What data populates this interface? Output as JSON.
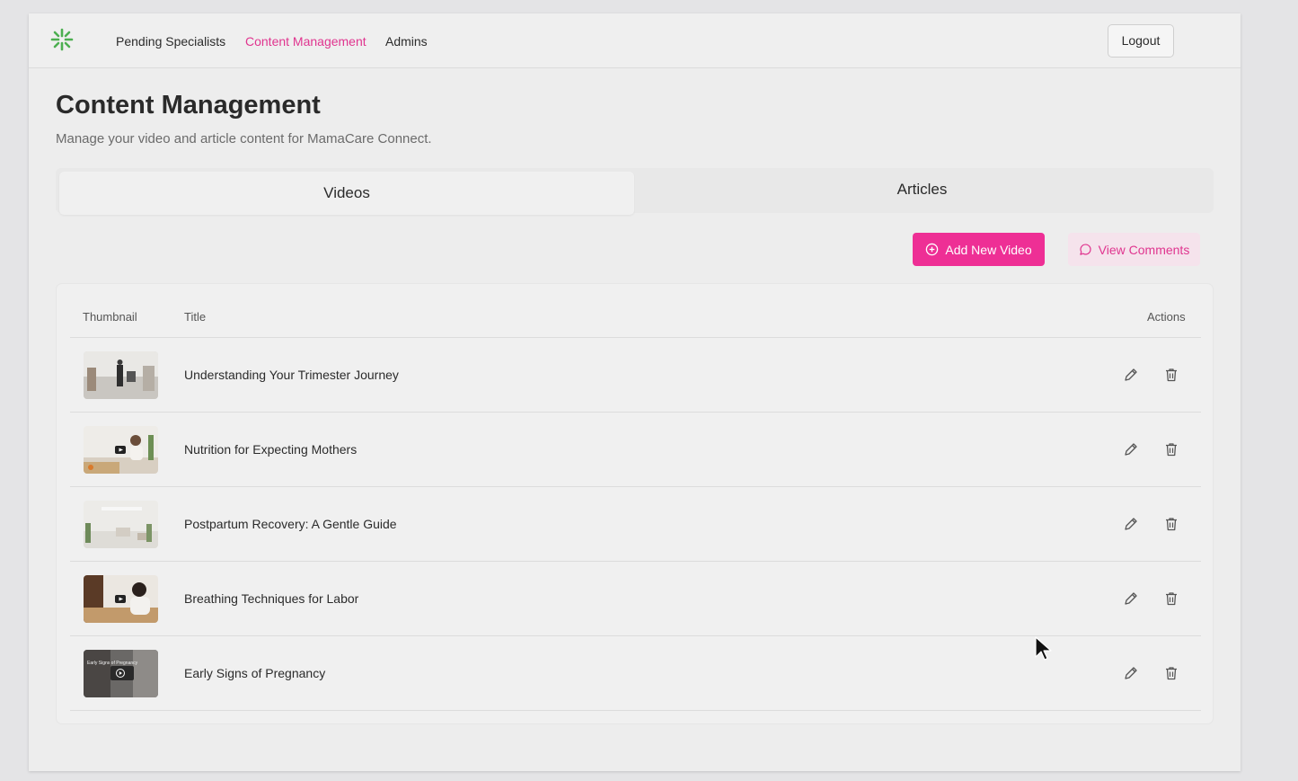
{
  "nav": {
    "links": [
      "Pending Specialists",
      "Content Management",
      "Admins"
    ],
    "active": "Content Management",
    "logout_label": "Logout"
  },
  "header": {
    "title": "Content Management",
    "subtitle": "Manage your video and article content for MamaCare Connect."
  },
  "tabs": [
    {
      "label": "Videos",
      "active": true
    },
    {
      "label": "Articles",
      "active": false
    }
  ],
  "toolbar": {
    "add_label": "Add New Video",
    "comments_label": "View Comments"
  },
  "table": {
    "columns": {
      "thumbnail": "Thumbnail",
      "title": "Title",
      "actions": "Actions"
    },
    "rows": [
      {
        "title": "Understanding Your Trimester Journey"
      },
      {
        "title": "Nutrition for Expecting Mothers"
      },
      {
        "title": "Postpartum Recovery: A Gentle Guide"
      },
      {
        "title": "Breathing Techniques for Labor"
      },
      {
        "title": "Early Signs of Pregnancy",
        "thumbnail_text": "Early Signs of Pregnancy"
      }
    ]
  },
  "colors": {
    "accent": "#ee2f95",
    "accent_text": "#e0358f",
    "accent_soft": "#f5e3ec",
    "logo_green": "#4caf50"
  }
}
